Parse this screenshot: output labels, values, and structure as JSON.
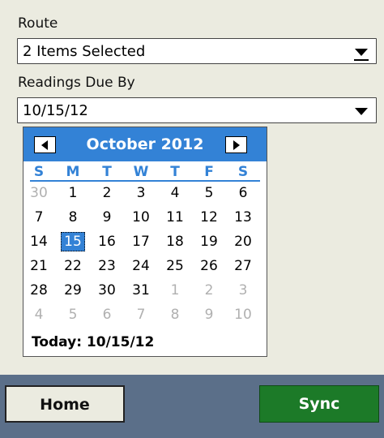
{
  "route": {
    "label": "Route",
    "value": "2 Items Selected"
  },
  "readings": {
    "label": "Readings Due By",
    "value": "10/15/12"
  },
  "calendar": {
    "title": "October 2012",
    "weekdays": [
      "S",
      "M",
      "T",
      "W",
      "T",
      "F",
      "S"
    ],
    "weeks": [
      [
        "30",
        "1",
        "2",
        "3",
        "4",
        "5",
        "6"
      ],
      [
        "7",
        "8",
        "9",
        "10",
        "11",
        "12",
        "13"
      ],
      [
        "14",
        "15",
        "16",
        "17",
        "18",
        "19",
        "20"
      ],
      [
        "21",
        "22",
        "23",
        "24",
        "25",
        "26",
        "27"
      ],
      [
        "28",
        "29",
        "30",
        "31",
        "1",
        "2",
        "3"
      ],
      [
        "4",
        "5",
        "6",
        "7",
        "8",
        "9",
        "10"
      ]
    ],
    "selected": "15",
    "today_text": "Today: 10/15/12",
    "accent": "#3382d6"
  },
  "buttons": {
    "home": "Home",
    "sync": "Sync"
  },
  "colors": {
    "background": "#ebebe0",
    "bottom_bar": "#5b6f89",
    "sync": "#1c7a28"
  }
}
